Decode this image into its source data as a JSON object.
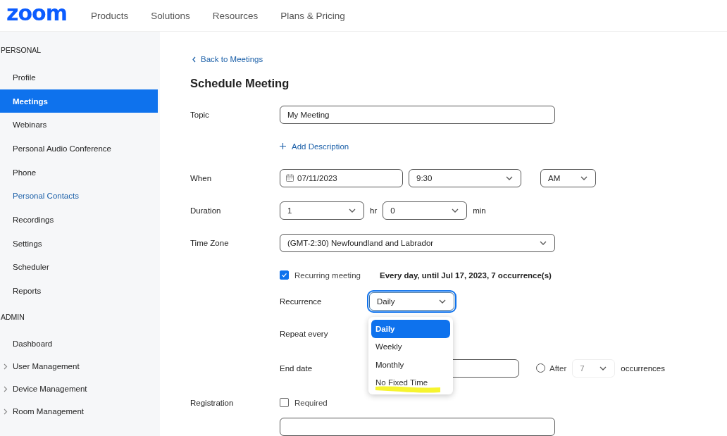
{
  "header": {
    "logo": "zoom",
    "nav": [
      "Products",
      "Solutions",
      "Resources",
      "Plans & Pricing"
    ]
  },
  "sidebar": {
    "sections": [
      {
        "heading": "PERSONAL",
        "items": [
          {
            "label": "Profile",
            "selected": false,
            "kind": "plain",
            "expandable": false
          },
          {
            "label": "Meetings",
            "selected": true,
            "kind": "plain",
            "expandable": false
          },
          {
            "label": "Webinars",
            "selected": false,
            "kind": "plain",
            "expandable": false
          },
          {
            "label": "Personal Audio Conference",
            "selected": false,
            "kind": "plain",
            "expandable": false
          },
          {
            "label": "Phone",
            "selected": false,
            "kind": "plain",
            "expandable": false
          },
          {
            "label": "Personal Contacts",
            "selected": false,
            "kind": "link",
            "expandable": false
          },
          {
            "label": "Recordings",
            "selected": false,
            "kind": "plain",
            "expandable": false
          },
          {
            "label": "Settings",
            "selected": false,
            "kind": "plain",
            "expandable": false
          },
          {
            "label": "Scheduler",
            "selected": false,
            "kind": "plain",
            "expandable": false
          },
          {
            "label": "Reports",
            "selected": false,
            "kind": "plain",
            "expandable": false
          }
        ]
      },
      {
        "heading": "ADMIN",
        "items": [
          {
            "label": "Dashboard",
            "selected": false,
            "kind": "plain",
            "expandable": false
          },
          {
            "label": "User Management",
            "selected": false,
            "kind": "plain",
            "expandable": true
          },
          {
            "label": "Device Management",
            "selected": false,
            "kind": "plain",
            "expandable": true
          },
          {
            "label": "Room Management",
            "selected": false,
            "kind": "plain",
            "expandable": true
          }
        ]
      }
    ]
  },
  "form": {
    "back_link": "Back to Meetings",
    "title": "Schedule Meeting",
    "topic": {
      "label": "Topic",
      "value": "My Meeting"
    },
    "add_description": "Add Description",
    "when": {
      "label": "When",
      "date": "07/11/2023",
      "time": "9:30",
      "period": "AM"
    },
    "duration": {
      "label": "Duration",
      "hours": "1",
      "hours_unit": "hr",
      "minutes": "0",
      "minutes_unit": "min"
    },
    "time_zone": {
      "label": "Time Zone",
      "value": "(GMT-2:30) Newfoundland and Labrador"
    },
    "recurring": {
      "label": "Recurring meeting",
      "checked": true,
      "summary": "Every day, until Jul 17, 2023, 7 occurrence(s)"
    },
    "recurrence": {
      "label": "Recurrence",
      "value": "Daily",
      "expanded": true,
      "options": [
        {
          "label": "Daily",
          "selected": true,
          "highlighted": false
        },
        {
          "label": "Weekly",
          "selected": false,
          "highlighted": false
        },
        {
          "label": "Monthly",
          "selected": false,
          "highlighted": false
        },
        {
          "label": "No Fixed Time",
          "selected": false,
          "highlighted": true
        }
      ]
    },
    "repeat_every": {
      "label": "Repeat every"
    },
    "end_date": {
      "label": "End date",
      "after_label": "After",
      "after_selected": false,
      "occurrences": "7",
      "occurrences_unit": "occurrences"
    },
    "registration": {
      "label": "Registration",
      "required_label": "Required",
      "checked": false
    }
  }
}
